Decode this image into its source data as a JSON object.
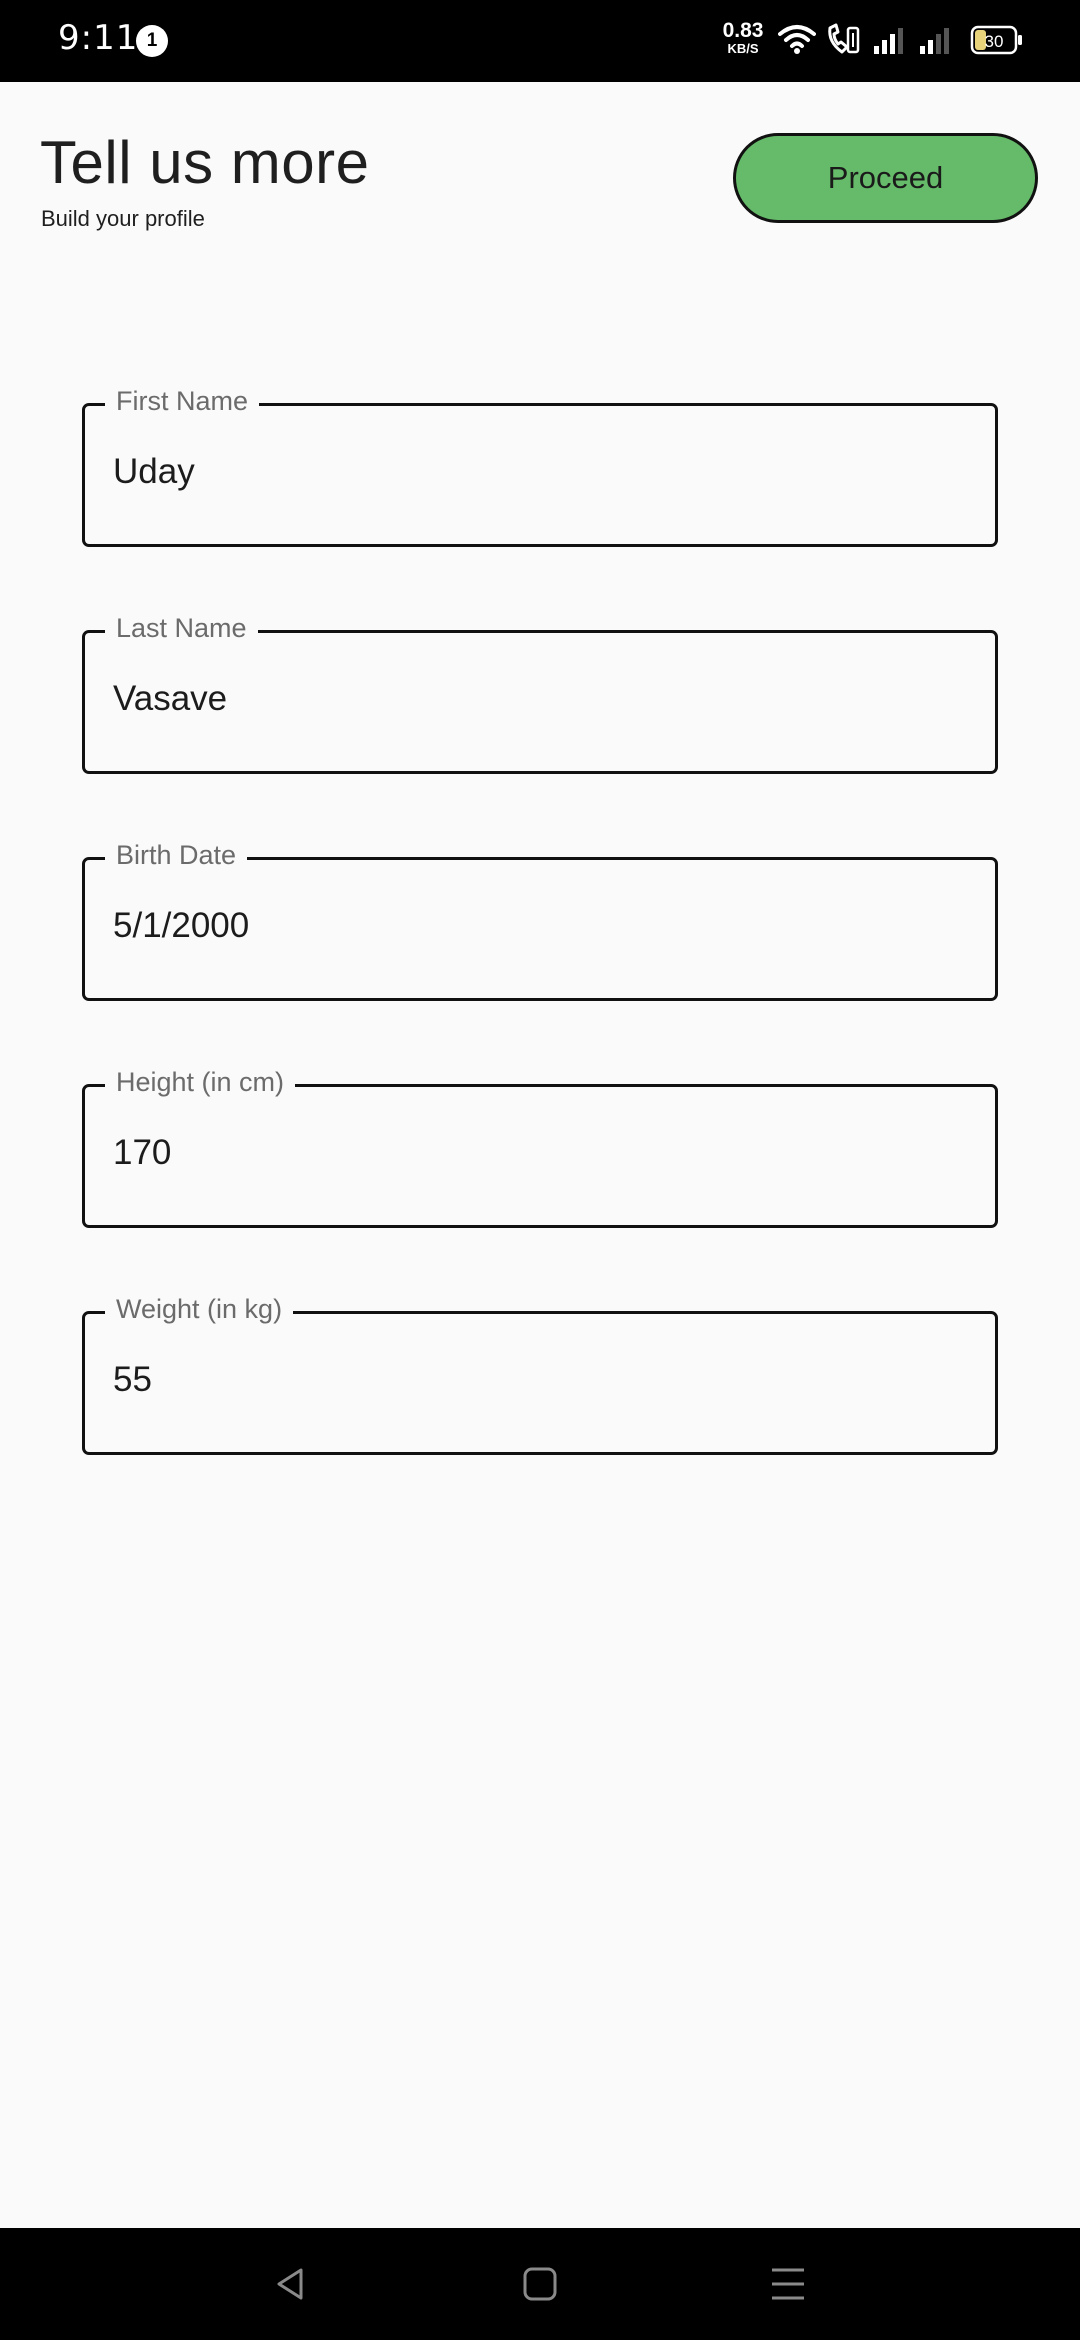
{
  "status_bar": {
    "time": "9:11",
    "notification_count": "1",
    "net_speed_value": "0.83",
    "net_speed_unit": "KB/S",
    "battery_level": "30"
  },
  "header": {
    "title": "Tell us more",
    "subtitle": "Build your profile",
    "proceed_label": "Proceed"
  },
  "form": {
    "fields": [
      {
        "label": "First Name",
        "value": "Uday"
      },
      {
        "label": "Last Name",
        "value": "Vasave"
      },
      {
        "label": "Birth Date",
        "value": "5/1/2000"
      },
      {
        "label": "Height (in cm)",
        "value": "170"
      },
      {
        "label": "Weight (in kg)",
        "value": "55"
      }
    ]
  },
  "colors": {
    "proceed_button": "#66bb6a",
    "background": "#fafafa",
    "border": "#111111"
  },
  "icons": {
    "status": [
      "wifi-icon",
      "volte-call-icon",
      "signal-sim1-icon",
      "signal-sim2-icon",
      "battery-icon"
    ],
    "nav": [
      "back-icon",
      "home-icon",
      "recents-icon"
    ]
  }
}
